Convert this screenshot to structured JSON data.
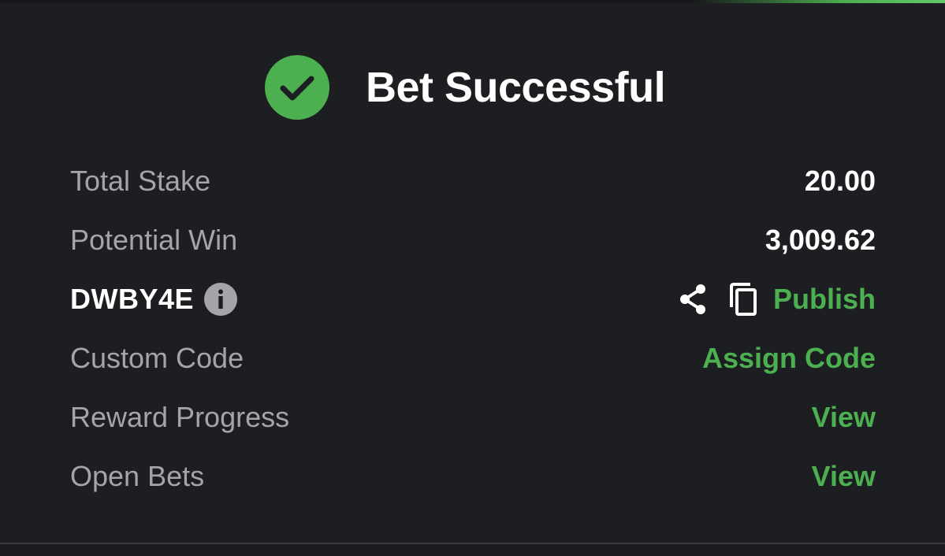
{
  "colors": {
    "background": "#1d1e22",
    "accent_green": "#4caf50",
    "label_gray": "#a3a5ab",
    "value_white": "#ffffff"
  },
  "header": {
    "icon": "check-circle-icon",
    "title": "Bet Successful"
  },
  "rows": {
    "total_stake": {
      "label": "Total Stake",
      "value": "20.00"
    },
    "potential_win": {
      "label": "Potential Win",
      "value": "3,009.62"
    },
    "booking": {
      "code": "DWBY4E",
      "info_icon": "info-icon",
      "share_icon": "share-icon",
      "copy_icon": "copy-icon",
      "publish_label": "Publish"
    },
    "custom_code": {
      "label": "Custom Code",
      "action": "Assign Code"
    },
    "reward_progress": {
      "label": "Reward Progress",
      "action": "View"
    },
    "open_bets": {
      "label": "Open Bets",
      "action": "View"
    }
  }
}
